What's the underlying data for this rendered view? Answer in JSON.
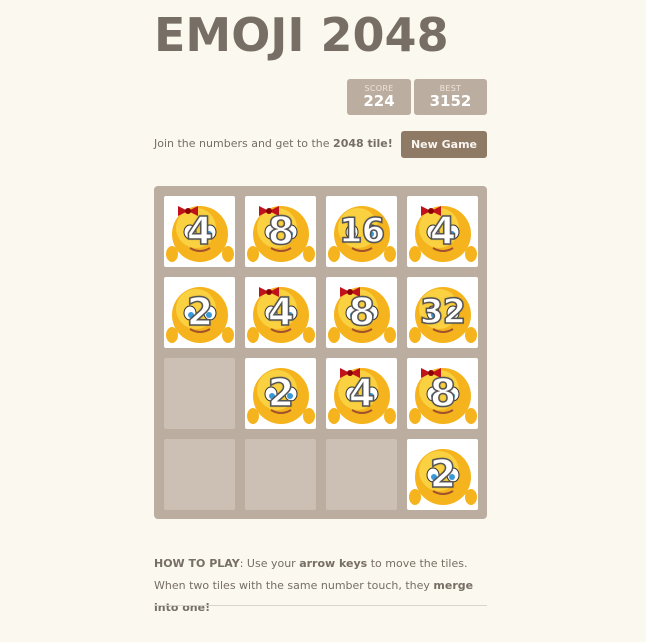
{
  "header": {
    "title": "EMOJI 2048",
    "score_label": "SCORE",
    "score_value": "224",
    "best_label": "BEST",
    "best_value": "3152"
  },
  "intro": {
    "text_before": "Join the numbers and get to the ",
    "text_bold": "2048 tile!",
    "new_game_label": "New Game"
  },
  "board": {
    "tiles": [
      {
        "row": 1,
        "col": 1,
        "value": "4"
      },
      {
        "row": 1,
        "col": 2,
        "value": "8"
      },
      {
        "row": 1,
        "col": 3,
        "value": "16"
      },
      {
        "row": 1,
        "col": 4,
        "value": "4"
      },
      {
        "row": 2,
        "col": 1,
        "value": "2"
      },
      {
        "row": 2,
        "col": 2,
        "value": "4"
      },
      {
        "row": 2,
        "col": 3,
        "value": "8"
      },
      {
        "row": 2,
        "col": 4,
        "value": "32"
      },
      {
        "row": 3,
        "col": 2,
        "value": "2"
      },
      {
        "row": 3,
        "col": 3,
        "value": "4"
      },
      {
        "row": 3,
        "col": 4,
        "value": "8"
      },
      {
        "row": 4,
        "col": 4,
        "value": "2"
      }
    ]
  },
  "howto": {
    "label": "HOW TO PLAY",
    "part1": ": Use your ",
    "bold1": "arrow keys",
    "part2": " to move the tiles. When two tiles with the same number touch, they ",
    "bold2": "merge into one!"
  },
  "colors": {
    "background": "#faf8ef",
    "board": "#bbada0",
    "button": "#8f7a66",
    "text": "#776e65"
  }
}
